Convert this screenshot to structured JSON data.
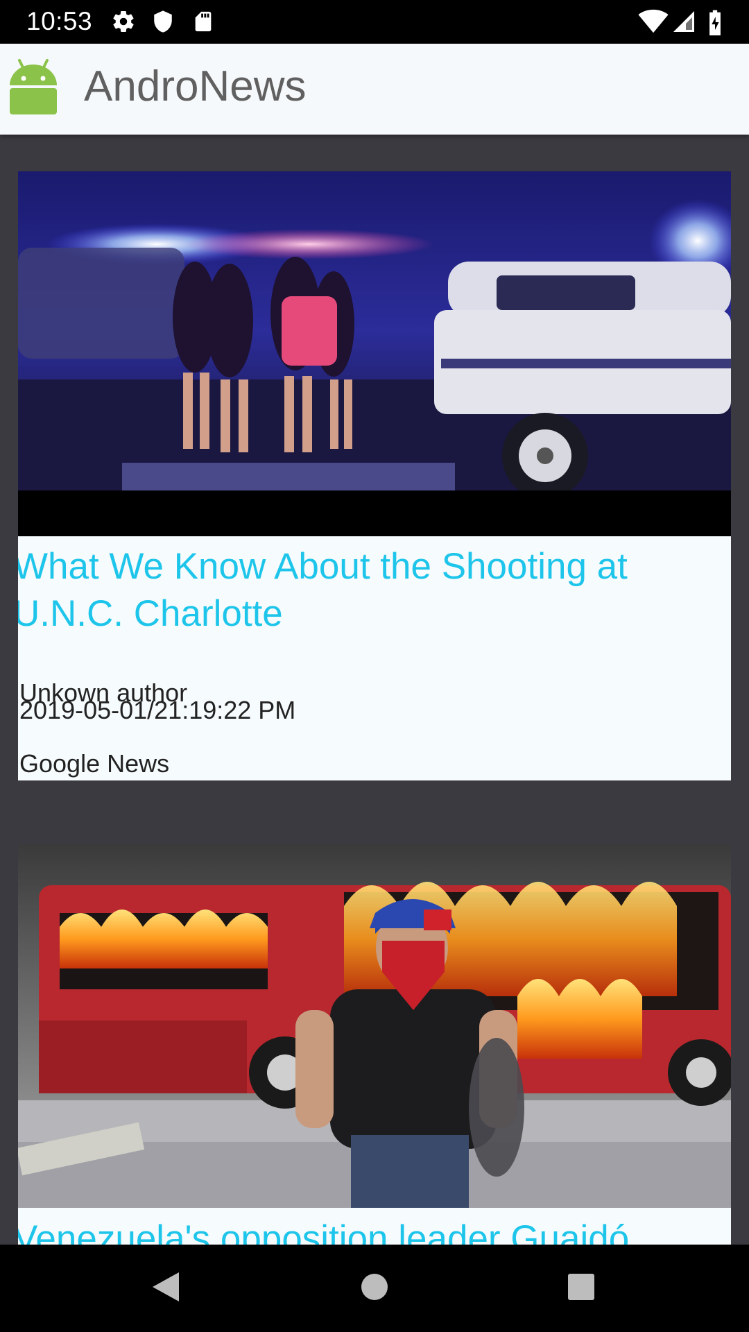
{
  "status_bar": {
    "time": "10:53",
    "icons": [
      "gear-icon",
      "shield-icon",
      "sd-card-icon",
      "wifi-icon",
      "signal-icon",
      "battery-charging-icon"
    ]
  },
  "app_bar": {
    "title": "AndroNews",
    "logo": "android-icon"
  },
  "articles": [
    {
      "title_line1": "What We Know About the Shooting at",
      "title_line2": "U.N.C. Charlotte",
      "author": "Unkown author",
      "date": "2019-05-01/21:19:22 PM",
      "source": "Google News",
      "image": "night-police-scene-photo"
    },
    {
      "title_line1": "Venezuela's opposition leader Guaidó",
      "image": "burning-bus-protest-photo"
    }
  ],
  "nav_bar": {
    "buttons": [
      "back-icon",
      "home-icon",
      "recents-icon"
    ]
  },
  "colors": {
    "title_accent": "#1ec5ea",
    "feed_background": "#3b3a40",
    "app_bar": "#f6f9fb",
    "android_green": "#8bc34a"
  }
}
